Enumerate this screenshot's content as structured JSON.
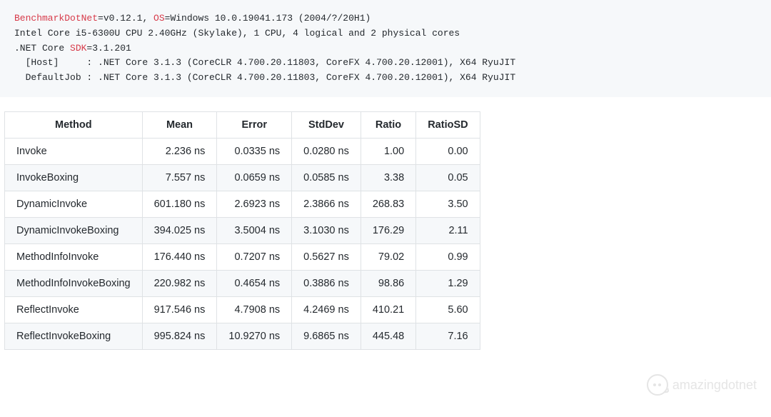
{
  "code": {
    "t1_red": "BenchmarkDotNet",
    "t1_a": "=v0.12.1, ",
    "t1_os_red": "OS",
    "t1_b": "=Windows 10.0.19041.173 (2004/?/20H1)",
    "t2": "Intel Core i5-6300U CPU 2.40GHz (Skylake), 1 CPU, 4 logical and 2 physical cores",
    "t3_a": ".NET Core ",
    "t3_sdk_red": "SDK",
    "t3_b": "=3.1.201",
    "t4": "  [Host]     : .NET Core 3.1.3 (CoreCLR 4.700.20.11803, CoreFX 4.700.20.12001), X64 RyuJIT",
    "t5": "  DefaultJob : .NET Core 3.1.3 (CoreCLR 4.700.20.11803, CoreFX 4.700.20.12001), X64 RyuJIT"
  },
  "table": {
    "headers": [
      "Method",
      "Mean",
      "Error",
      "StdDev",
      "Ratio",
      "RatioSD"
    ],
    "rows": [
      [
        "Invoke",
        "2.236 ns",
        "0.0335 ns",
        "0.0280 ns",
        "1.00",
        "0.00"
      ],
      [
        "InvokeBoxing",
        "7.557 ns",
        "0.0659 ns",
        "0.0585 ns",
        "3.38",
        "0.05"
      ],
      [
        "DynamicInvoke",
        "601.180 ns",
        "2.6923 ns",
        "2.3866 ns",
        "268.83",
        "3.50"
      ],
      [
        "DynamicInvokeBoxing",
        "394.025 ns",
        "3.5004 ns",
        "3.1030 ns",
        "176.29",
        "2.11"
      ],
      [
        "MethodInfoInvoke",
        "176.440 ns",
        "0.7207 ns",
        "0.5627 ns",
        "79.02",
        "0.99"
      ],
      [
        "MethodInfoInvokeBoxing",
        "220.982 ns",
        "0.4654 ns",
        "0.3886 ns",
        "98.86",
        "1.29"
      ],
      [
        "ReflectInvoke",
        "917.546 ns",
        "4.7908 ns",
        "4.2469 ns",
        "410.21",
        "5.60"
      ],
      [
        "ReflectInvokeBoxing",
        "995.824 ns",
        "10.9270 ns",
        "9.6865 ns",
        "445.48",
        "7.16"
      ]
    ]
  },
  "watermark": {
    "label": "amazingdotnet"
  }
}
